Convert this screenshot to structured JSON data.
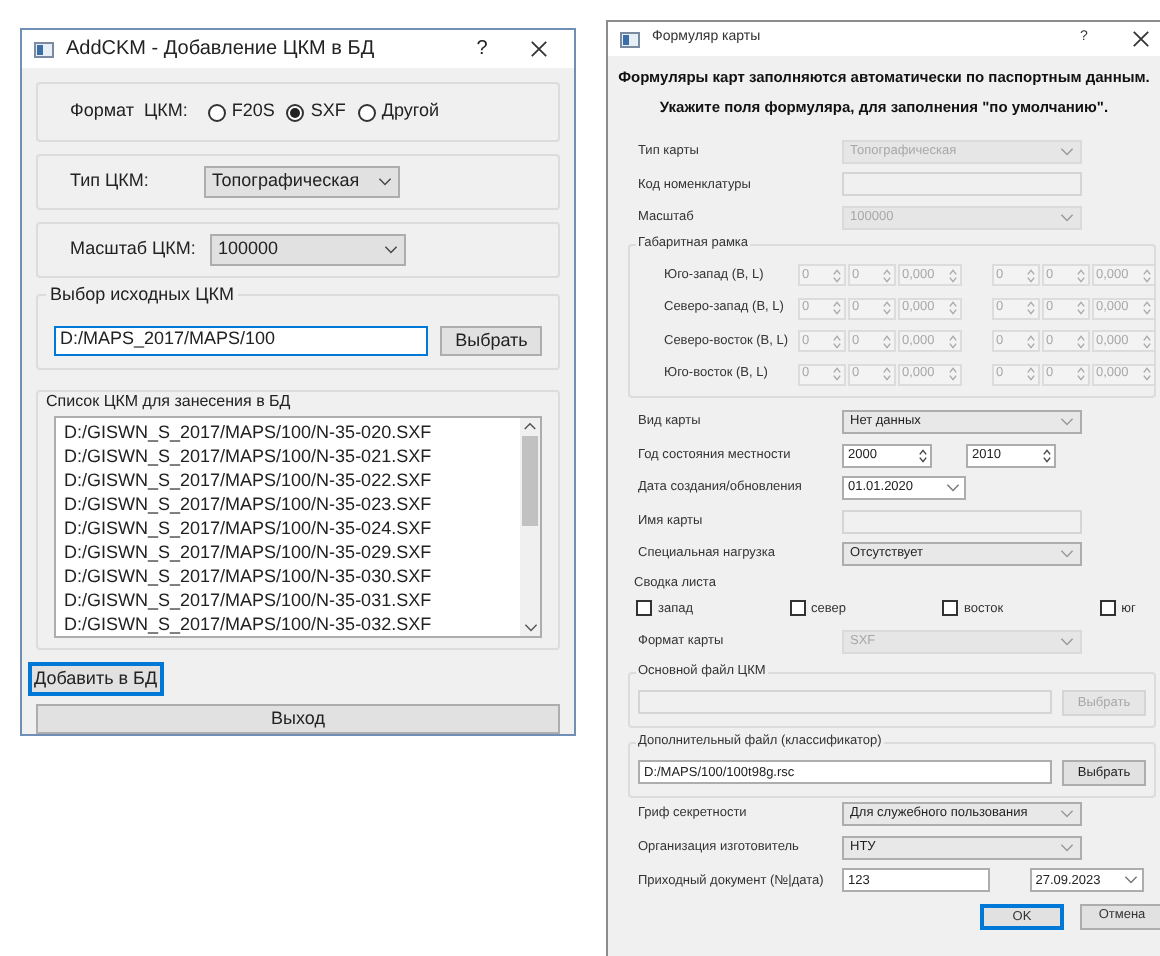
{
  "left_window": {
    "title": "AddCKM - Добавление ЦКМ в БД",
    "help": "?",
    "format": {
      "label": "Формат  ЦКМ:",
      "options": [
        {
          "label": "F20S",
          "selected": false
        },
        {
          "label": "SXF",
          "selected": true
        },
        {
          "label": "Другой",
          "selected": false
        }
      ]
    },
    "map_type": {
      "label": "Тип ЦКМ:",
      "value": "Топографическая"
    },
    "scale": {
      "label": "Масштаб ЦКМ:",
      "value": "100000"
    },
    "source": {
      "title": "Выбор исходных ЦКМ",
      "path": "D:/MAPS_2017/MAPS/100",
      "button": "Выбрать"
    },
    "list": {
      "title": "Список ЦКМ для занесения в БД",
      "items": [
        "D:/GISWN_S_2017/MAPS/100/N-35-020.SXF",
        "D:/GISWN_S_2017/MAPS/100/N-35-021.SXF",
        "D:/GISWN_S_2017/MAPS/100/N-35-022.SXF",
        "D:/GISWN_S_2017/MAPS/100/N-35-023.SXF",
        "D:/GISWN_S_2017/MAPS/100/N-35-024.SXF",
        "D:/GISWN_S_2017/MAPS/100/N-35-029.SXF",
        "D:/GISWN_S_2017/MAPS/100/N-35-030.SXF",
        "D:/GISWN_S_2017/MAPS/100/N-35-031.SXF",
        "D:/GISWN_S_2017/MAPS/100/N-35-032.SXF"
      ]
    },
    "buttons": [
      {
        "label": "Добавить в БД",
        "focused": true,
        "kind": "compact"
      },
      {
        "label": "Выход",
        "focused": false,
        "kind": "full"
      }
    ]
  },
  "right_window": {
    "title": "Формуляр карты",
    "help": "?",
    "info": [
      "Формуляры карт заполняются автоматически по паспортным данным.",
      "Укажите поля формуляра, для заполнения \"по умолчанию\"."
    ],
    "sections": [
      {
        "kind": "row",
        "label": "Тип карты",
        "controls": [
          {
            "kind": "combo",
            "value": "Топографическая",
            "disabled": true
          }
        ]
      },
      {
        "kind": "row",
        "label": "Код номенклатуры",
        "controls": [
          {
            "kind": "input",
            "disabled": true
          }
        ]
      },
      {
        "kind": "row",
        "label": "Масштаб",
        "controls": [
          {
            "kind": "combo",
            "value": "100000",
            "disabled": true
          }
        ]
      },
      {
        "kind": "frame",
        "title": "Габаритная рамка",
        "disabled": true,
        "rows": [
          {
            "label": "Юго-запад (B, L)",
            "values": [
              "0",
              "0",
              "0,000",
              "0",
              "0",
              "0,000"
            ]
          },
          {
            "label": "Северо-запад (B, L)",
            "values": [
              "0",
              "0",
              "0,000",
              "0",
              "0",
              "0,000"
            ]
          },
          {
            "label": "Северо-восток (B, L)",
            "values": [
              "0",
              "0",
              "0,000",
              "0",
              "0",
              "0,000"
            ]
          },
          {
            "label": "Юго-восток (B, L)",
            "values": [
              "0",
              "0",
              "0,000",
              "0",
              "0",
              "0,000"
            ]
          }
        ]
      },
      {
        "kind": "row",
        "label": "Вид карты",
        "controls": [
          {
            "kind": "combo",
            "value": "Нет данных",
            "disabled": false
          }
        ]
      },
      {
        "kind": "row",
        "label": "Год состояния местности",
        "controls": [
          {
            "kind": "spin",
            "value": "2000",
            "disabled": false
          },
          {
            "kind": "spin",
            "value": "2010",
            "disabled": false
          }
        ]
      },
      {
        "kind": "row",
        "label": "Дата создания/обновления",
        "controls": [
          {
            "kind": "date",
            "value": "01.01.2020",
            "disabled": false
          }
        ]
      },
      {
        "kind": "row",
        "label": "Имя карты",
        "controls": [
          {
            "kind": "input",
            "disabled": true
          }
        ]
      },
      {
        "kind": "row",
        "label": "Специальная нагрузка",
        "controls": [
          {
            "kind": "combo",
            "value": "Отсутствует",
            "disabled": false
          }
        ]
      },
      {
        "kind": "checks",
        "title": "Сводка листа",
        "items": [
          {
            "label": "запад",
            "checked": false
          },
          {
            "label": "север",
            "checked": false
          },
          {
            "label": "восток",
            "checked": false
          },
          {
            "label": "юг",
            "checked": false
          }
        ]
      },
      {
        "kind": "row",
        "label": "Формат карты",
        "controls": [
          {
            "kind": "combo",
            "value": "SXF",
            "disabled": true
          }
        ]
      },
      {
        "kind": "file",
        "title": "Основной файл ЦКМ",
        "button": "Выбрать",
        "disabled": true
      },
      {
        "kind": "file",
        "title": "Дополнительный файл (классификатор)",
        "value": "D:/MAPS/100/100t98g.rsc",
        "button": "Выбрать",
        "disabled": false
      },
      {
        "kind": "row",
        "label": "Гриф секретности",
        "controls": [
          {
            "kind": "combo",
            "value": "Для служебного пользования",
            "disabled": false
          }
        ]
      },
      {
        "kind": "row",
        "label": "Организация изготовитель",
        "controls": [
          {
            "kind": "combo",
            "value": "НТУ",
            "disabled": false
          }
        ]
      },
      {
        "kind": "row",
        "label": "Приходный документ (№|дата)",
        "controls": [
          {
            "kind": "text",
            "value": "123",
            "disabled": false
          },
          {
            "kind": "date2",
            "value": "27.09.2023",
            "disabled": false
          }
        ]
      }
    ],
    "buttons": [
      {
        "label": "OK",
        "focused": true
      },
      {
        "label": "Отмена",
        "focused": false
      }
    ]
  }
}
